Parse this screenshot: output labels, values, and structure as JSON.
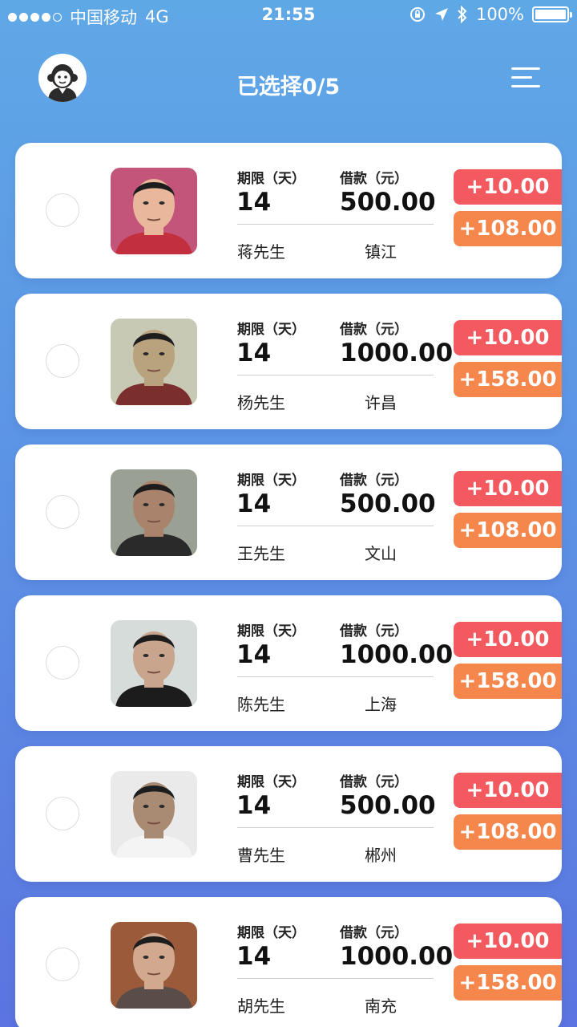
{
  "status_bar": {
    "carrier": "中国移动",
    "network": "4G",
    "time": "21:55",
    "battery": "100%"
  },
  "header": {
    "title": "已选择0/5"
  },
  "labels": {
    "term": "期限（天）",
    "loan": "借款（元）"
  },
  "cards": [
    {
      "term": "14",
      "amount": "500.00",
      "name": "蒋先生",
      "city": "镇江",
      "fee1": "+10.00",
      "fee2": "+108.00",
      "skin": "#e8b79c",
      "bg": "#c4557a",
      "shirt": "#c23040"
    },
    {
      "term": "14",
      "amount": "1000.00",
      "name": "杨先生",
      "city": "许昌",
      "fee1": "+10.00",
      "fee2": "+158.00",
      "skin": "#b9a37e",
      "bg": "#c8c9b4",
      "shirt": "#7a2f2c"
    },
    {
      "term": "14",
      "amount": "500.00",
      "name": "王先生",
      "city": "文山",
      "fee1": "+10.00",
      "fee2": "+108.00",
      "skin": "#a9836b",
      "bg": "#9aa194",
      "shirt": "#2a2a2a"
    },
    {
      "term": "14",
      "amount": "1000.00",
      "name": "陈先生",
      "city": "上海",
      "fee1": "+10.00",
      "fee2": "+158.00",
      "skin": "#c9a58d",
      "bg": "#d6dcda",
      "shirt": "#1c1c1c"
    },
    {
      "term": "14",
      "amount": "500.00",
      "name": "曹先生",
      "city": "郴州",
      "fee1": "+10.00",
      "fee2": "+108.00",
      "skin": "#a98a72",
      "bg": "#eaeaea",
      "shirt": "#f4f4f4"
    },
    {
      "term": "14",
      "amount": "1000.00",
      "name": "胡先生",
      "city": "南充",
      "fee1": "+10.00",
      "fee2": "+158.00",
      "skin": "#d2a98e",
      "bg": "#9b5a3a",
      "shirt": "#5a4c48"
    }
  ],
  "colors": {
    "accent_red": "#f25a5f",
    "accent_orange": "#f6874c",
    "background_top": "#5fa8e6",
    "background_bottom": "#5b74e0"
  },
  "icons": {
    "avatar": "monkey-avatar-icon",
    "menu": "menu-icon",
    "radio": "radio-unchecked-icon"
  }
}
